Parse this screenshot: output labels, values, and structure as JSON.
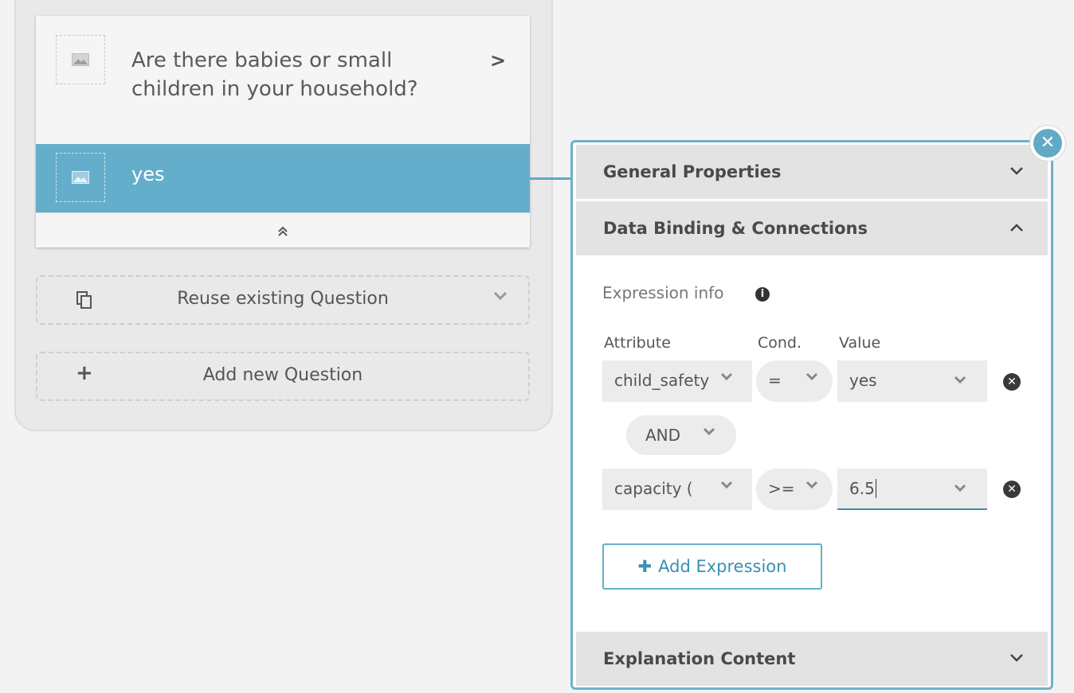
{
  "question_card": {
    "question": "Are there babies or small children in your household?",
    "next_icon": "chevron-right-icon",
    "answer": "yes",
    "collapse_icon": "double-chevron-up-icon"
  },
  "actions": {
    "reuse_label": "Reuse existing Question",
    "add_label": "Add new Question"
  },
  "panel": {
    "sections": {
      "general": "General Properties",
      "binding": "Data Binding & Connections",
      "explanation": "Explanation Content"
    },
    "expression_info": "Expression info",
    "columns": {
      "attribute": "Attribute",
      "cond": "Cond.",
      "value": "Value"
    },
    "expressions": [
      {
        "attribute": "child_safety",
        "cond": "=",
        "value": "yes"
      },
      {
        "attribute": "capacity (",
        "cond": ">=",
        "value": "6.5"
      }
    ],
    "connector": "AND",
    "add_expression_label": "Add Expression"
  },
  "colors": {
    "accent": "#64aecb",
    "panel_border": "#6fb0c9",
    "link": "#3b8fb3"
  }
}
